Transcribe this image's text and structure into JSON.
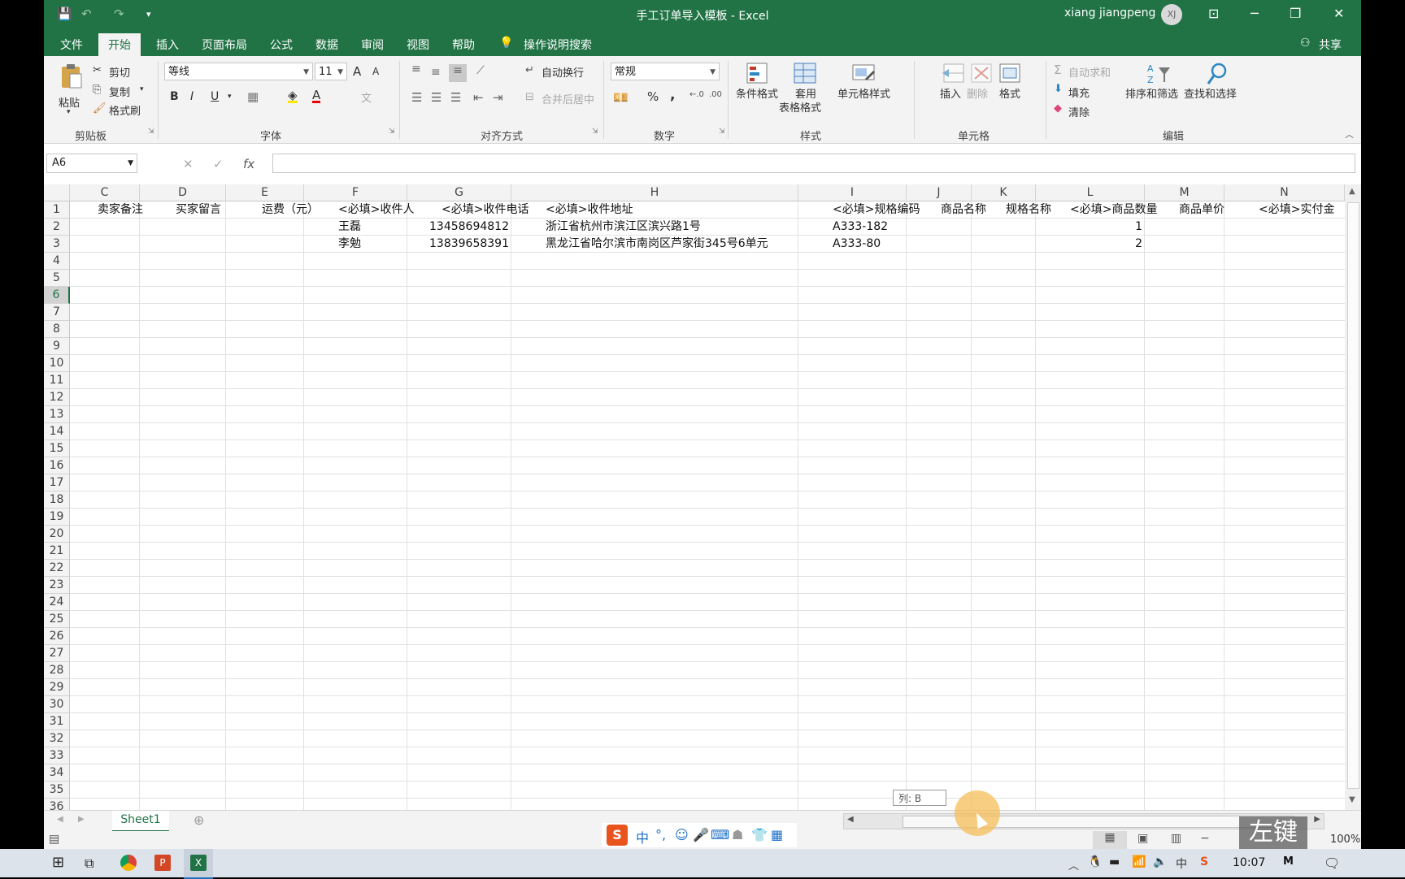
{
  "window": {
    "title": "手工订单导入模板  -  Excel",
    "user_name": "xiang jiangpeng",
    "user_initials": "XJ",
    "minimize": "─",
    "restore": "❐",
    "close": "✕",
    "ribbon_display": "⊡"
  },
  "menu": {
    "items": [
      "文件",
      "开始",
      "插入",
      "页面布局",
      "公式",
      "数据",
      "审阅",
      "视图",
      "帮助"
    ],
    "search": "操作说明搜索",
    "share": "共享"
  },
  "ribbon": {
    "clipboard": {
      "paste": "粘贴",
      "cut": "剪切",
      "copy": "复制",
      "format_painter": "格式刷",
      "group": "剪贴板"
    },
    "font": {
      "name": "等线",
      "size": "11",
      "bold": "B",
      "italic": "I",
      "underline": "U",
      "grow": "A",
      "shrink": "A",
      "group": "字体"
    },
    "alignment": {
      "wrap": "自动换行",
      "merge": "合并后居中",
      "group": "对齐方式"
    },
    "number": {
      "format": "常规",
      "percent": "%",
      "comma": ",",
      "group": "数字"
    },
    "styles": {
      "conditional": "条件格式",
      "table1": "套用",
      "table2": "表格格式",
      "cell_styles": "单元格样式",
      "group": "样式"
    },
    "cells": {
      "insert": "插入",
      "delete": "删除",
      "format": "格式",
      "group": "单元格"
    },
    "editing": {
      "autosum": "自动求和",
      "fill": "填充",
      "clear": "清除",
      "sort": "排序和筛选",
      "find": "查找和选择",
      "group": "编辑"
    }
  },
  "formula": {
    "name_box": "A6",
    "fx": "fx",
    "cancel": "✕",
    "enter": "✓",
    "value": ""
  },
  "sheet": {
    "columns": [
      "C",
      "D",
      "E",
      "F",
      "G",
      "H",
      "I",
      "J",
      "K",
      "L",
      "M",
      "N"
    ],
    "rows": [
      "1",
      "2",
      "3",
      "4",
      "5",
      "6",
      "7",
      "8",
      "9",
      "10",
      "11",
      "12",
      "13",
      "14",
      "15",
      "16",
      "17",
      "18",
      "19",
      "20",
      "21",
      "22",
      "23",
      "24",
      "25",
      "26",
      "27",
      "28",
      "29",
      "30",
      "31",
      "32",
      "33",
      "34",
      "35",
      "36"
    ],
    "selected_row": "6",
    "row1": {
      "C": "卖家备注",
      "D": "买家留言",
      "E": "运费（元）",
      "F": "<必填>收件人",
      "G": "<必填>收件电话",
      "H": "<必填>收件地址",
      "I": "<必填>规格编码",
      "J": "商品名称",
      "K": "规格名称",
      "L": "<必填>商品数量",
      "M": "商品单价",
      "N": "<必填>实付金"
    },
    "row2": {
      "F": "王磊",
      "G": "13458694812",
      "H": "浙江省杭州市滨江区滨兴路1号",
      "I": "A333-182",
      "L": "1"
    },
    "row3": {
      "F": "李勉",
      "G": "13839658391",
      "H": "黑龙江省哈尔滨市南岗区芦家街345号6单元",
      "I": "A333-80",
      "L": "2"
    }
  },
  "sheet_tab": "Sheet1",
  "tooltip": "列: B",
  "zoom": "100%",
  "watermark": "左键",
  "clock": "10:07",
  "ime": {
    "cn": "中",
    "punct": "°,"
  }
}
